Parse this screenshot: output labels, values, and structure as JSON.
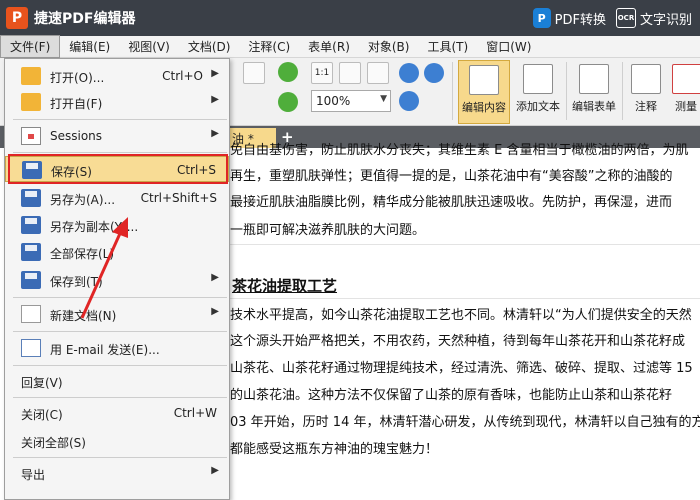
{
  "app": {
    "title": "捷速PDF编辑器",
    "logo_text": "P",
    "pdf_convert": "PDF转换",
    "pdf_icon_text": "P",
    "ocr": "文字识别",
    "ocr_icon_text": "OCR"
  },
  "menubar": [
    "文件(F)",
    "编辑(E)",
    "视图(V)",
    "文档(D)",
    "注释(C)",
    "表单(R)",
    "对象(B)",
    "工具(T)",
    "窗口(W)"
  ],
  "toolbar": {
    "zoom_value": "100%",
    "page_view_label": "1:1",
    "buttons": [
      "编辑内容",
      "添加文本",
      "编辑表单",
      "注释",
      "测量"
    ]
  },
  "tab": {
    "label": "油 *",
    "add": "+"
  },
  "file_menu": {
    "items": [
      {
        "label": "打开(O)...",
        "shortcut": "Ctrl+O",
        "submenu": true
      },
      {
        "label": "打开自(F)",
        "shortcut": "",
        "submenu": true
      },
      {
        "label": "Sessions",
        "shortcut": "",
        "submenu": true
      },
      {
        "label": "保存(S)",
        "shortcut": "Ctrl+S",
        "submenu": false
      },
      {
        "label": "另存为(A)...",
        "shortcut": "Ctrl+Shift+S",
        "submenu": false
      },
      {
        "label": "另存为副本(Y)...",
        "shortcut": "",
        "submenu": false
      },
      {
        "label": "全部保存(L)",
        "shortcut": "",
        "submenu": false
      },
      {
        "label": "保存到(T)",
        "shortcut": "",
        "submenu": true
      },
      {
        "label": "新建文档(N)",
        "shortcut": "",
        "submenu": true
      },
      {
        "label": "用 E-mail 发送(E)...",
        "shortcut": "",
        "submenu": false
      },
      {
        "label": "回复(V)",
        "shortcut": "",
        "submenu": false
      },
      {
        "label": "关闭(C)",
        "shortcut": "Ctrl+W",
        "submenu": false
      },
      {
        "label": "关闭全部(S)",
        "shortcut": "",
        "submenu": false
      },
      {
        "label": "导出",
        "shortcut": "",
        "submenu": true
      }
    ]
  },
  "document": {
    "lines": [
      "免自由基伤害，防止肌肤水分丧失；其维生素 E 含量相当于橄榄油的两倍，为肌",
      "再生，重塑肌肤弹性；更值得一提的是，山茶花油中有“美容酸”之称的油酸的",
      "最接近肌肤油脂膜比例，精华成分能被肌肤迅速吸收。先防护，再保湿，进而",
      "一瓶即可解决滋养肌肤的大问题。"
    ],
    "heading": "茶花油提取工艺",
    "lines2": [
      "技术水平提高，如今山茶花油提取工艺也不同。林清轩以“为人们提供安全的天然",
      "这个源头开始严格把关，不用农药，天然种植，待到每年山茶花开和山茶花籽成",
      "山茶花、山茶花籽通过物理提纯技术，经过清洗、筛选、破碎、提取、过滤等 15",
      "的山茶花油。这种方法不仅保留了山茶的原有香味，也能防止山茶和山茶花籽",
      "03 年开始，历时 14 年，林清轩潜心研发，从传统到现代，林清轩以自己独有的方",
      "都能感受这瓶东方神油的瑰宝魅力！"
    ]
  }
}
